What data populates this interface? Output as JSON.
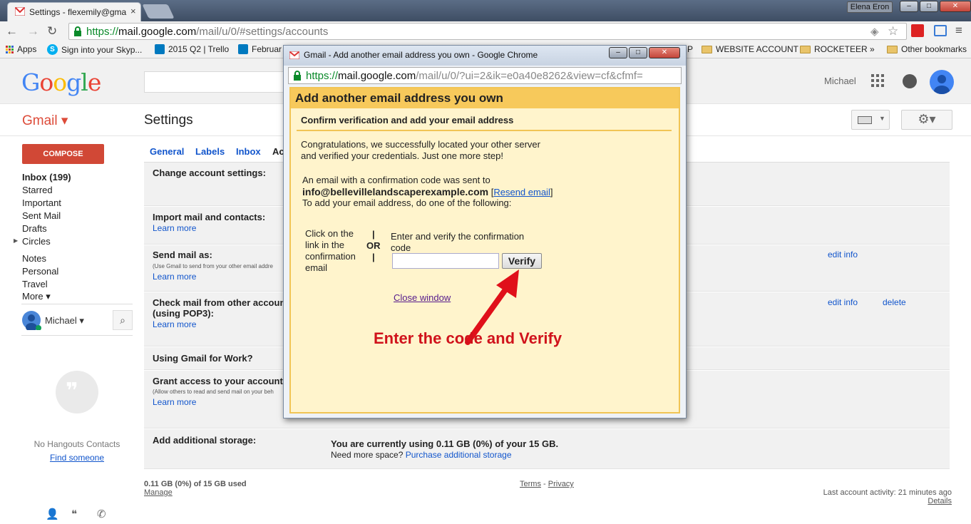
{
  "browser": {
    "tab_title": "Settings - flexemily@gma",
    "tab_close": "×",
    "user_badge": "Elena Eron",
    "url_scheme": "https://",
    "url_host": "mail.google.com",
    "url_path": "/mail/u/0/#settings/accounts",
    "bookmarks": {
      "apps": "Apps",
      "skype": "Sign into your Skyp...",
      "trello": "2015 Q2 | Trello",
      "february": "Februar",
      "p": "P",
      "website_account": "WEBSITE ACCOUNT",
      "rocketeer": "ROCKETEER",
      "more": "»",
      "other": "Other bookmarks"
    }
  },
  "gmail": {
    "logo": "Google",
    "account_name": "Michael",
    "gmail_label": "Gmail ▾",
    "settings_title": "Settings",
    "compose_label": "COMPOSE",
    "nav": [
      {
        "label": "Inbox (199)"
      },
      {
        "label": "Starred"
      },
      {
        "label": "Important"
      },
      {
        "label": "Sent Mail"
      },
      {
        "label": "Drafts"
      },
      {
        "label": "Circles"
      },
      {
        "label": "Notes"
      },
      {
        "label": "Personal"
      },
      {
        "label": "Travel"
      },
      {
        "label": "More ▾"
      }
    ],
    "hangouts_user": "Michael ▾",
    "no_hangouts": "No Hangouts Contacts",
    "find_someone": "Find someone",
    "settings_tabs": [
      "General",
      "Labels",
      "Inbox",
      "Ac"
    ],
    "rows": {
      "change_account": "Change account settings:",
      "import": "Import mail and contacts:",
      "learn_more": "Learn more",
      "send_as": "Send mail as:",
      "send_as_sub": "(Use Gmail to send from your other email addre",
      "edit_info": "edit info",
      "delete": "delete",
      "check_mail": "Check mail from other accoun",
      "check_mail_2": "(using POP3):",
      "gmail_work": "Using Gmail for Work?",
      "grant": "Grant access to your account:",
      "grant_sub": "(Allow others to read and send mail on your beh",
      "storage": "Add additional storage:",
      "storage_usage": "You are currently using 0.11 GB (0%) of your 15 GB.",
      "need_more": "Need more space?",
      "purchase": "Purchase additional storage"
    },
    "footer": {
      "usage": "0.11 GB (0%) of 15 GB used",
      "manage": "Manage",
      "terms": "Terms",
      "dash": "-",
      "privacy": "Privacy",
      "last_activity": "Last account activity: 21 minutes ago",
      "details": "Details"
    }
  },
  "popup": {
    "window_title": "Gmail - Add another email address you own - Google Chrome",
    "url_scheme": "https://",
    "url_host": "mail.google.com",
    "url_path": "/mail/u/0/?ui=2&ik=e0a40e8262&view=cf&cfmf=",
    "heading": "Add another email address you own",
    "subheading": "Confirm verification and add your email address",
    "congrats_1": "Congratulations, we successfully located your other server",
    "congrats_2": "and verified your credentials. Just one more step!",
    "sent_line": "An email with a confirmation code was sent to",
    "email": "info@bellevillelandscaperexample.com",
    "resend_open": "[",
    "resend": "Resend email",
    "resend_close": "]",
    "instruction": "To add your email address, do one of the following:",
    "click_link": "Click on the link in the confirmation email",
    "bar_top": "|",
    "or": "OR",
    "bar_bottom": "|",
    "enter_code": "Enter and verify the confirmation code",
    "code_value": "",
    "verify": "Verify",
    "close_window": "Close window",
    "annotation": "Enter the code and Verify"
  },
  "colors": {
    "compose": "#d14836",
    "link": "#1155cc",
    "popup_heading_bg": "#f7c95b",
    "popup_body_bg": "#fff4cc",
    "annotation": "#d0121b"
  }
}
